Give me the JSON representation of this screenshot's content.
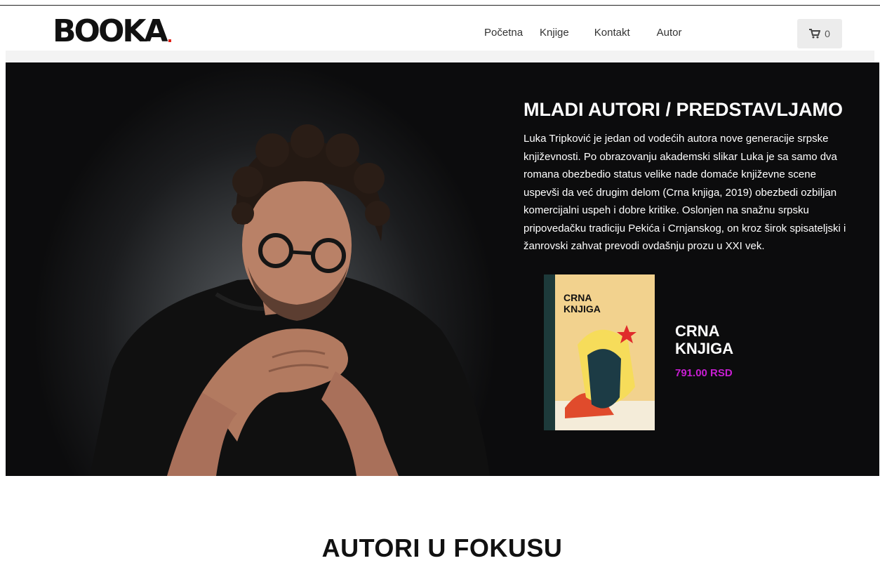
{
  "header": {
    "logo_text": "BOOKA",
    "nav": [
      "Početna",
      "Knjige",
      "Kontakt",
      "Autor"
    ],
    "cart_count": "0"
  },
  "hero": {
    "title": "MLADI AUTORI / PREDSTAVLJAMO",
    "text": "Luka Tripković je jedan od vodećih autora nove generacije srpske književnosti. Po obrazovanju akademski slikar Luka je sa samo dva romana obezbedio status velike nade domaće književne scene uspevši da već drugim delom (Crna knjiga, 2019) obezbedi ozbiljan komercijalni uspeh i dobre kritike. Oslonjen na snažnu srpsku pripovedačku tradiciju Pekića i Crnjanskog, on kroz širok spisateljski i žanrovski zahvat prevodi ovdašnju prozu u XXI vek.",
    "book": {
      "cover_title_line1": "CRNA",
      "cover_title_line2": "KNJIGA",
      "title_line1": "CRNA",
      "title_line2": "KNJIGA",
      "price": "791.00 RSD"
    }
  },
  "section": {
    "title": "AUTORI U FOKUSU"
  },
  "colors": {
    "accent": "#c81ed2",
    "hero_bg": "#0c0c0d"
  }
}
